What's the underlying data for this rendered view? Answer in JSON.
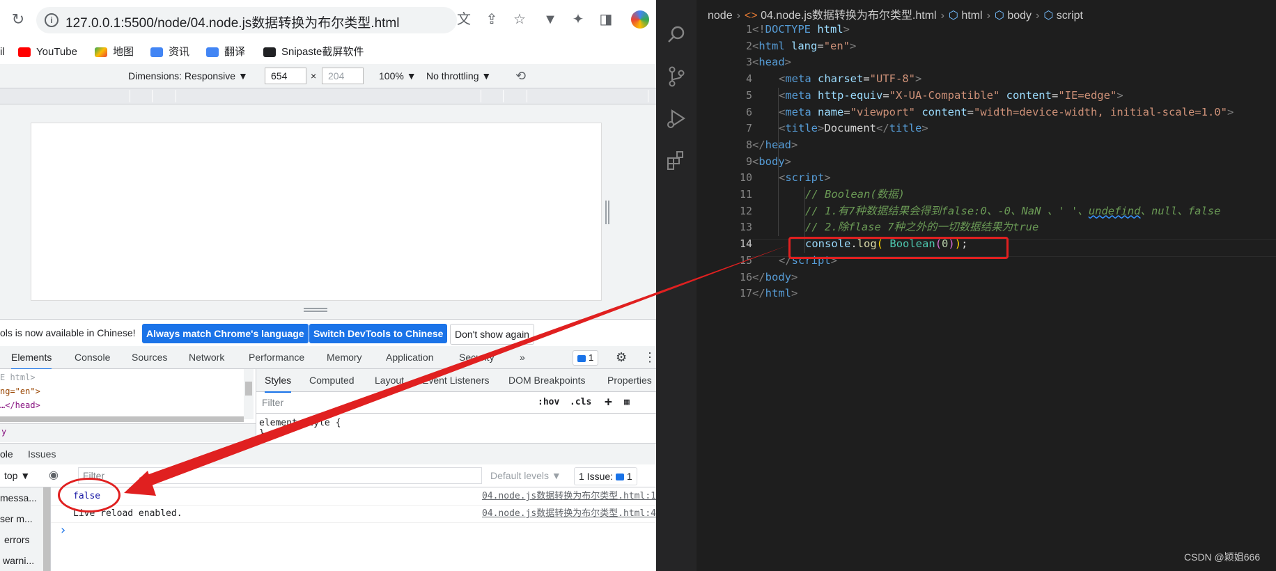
{
  "browser": {
    "url": "127.0.0.1:5500/node/04.node.js数据转换为布尔类型.html",
    "bookmarks": [
      {
        "label": "il"
      },
      {
        "label": "YouTube"
      },
      {
        "label": "地图"
      },
      {
        "label": "资讯"
      },
      {
        "label": "翻译"
      },
      {
        "label": "Snipaste截屏软件"
      }
    ],
    "device_toolbar": {
      "dimensions_label": "Dimensions: Responsive ▼",
      "width": "654",
      "times": "×",
      "height": "204",
      "zoom": "100% ▼",
      "throttle": "No throttling ▼"
    }
  },
  "devtools": {
    "lang_banner": {
      "text": "ols is now available in Chinese!",
      "match_btn": "Always match Chrome's language",
      "switch_btn": "Switch DevTools to Chinese",
      "dismiss_btn": "Don't show again"
    },
    "tabs": [
      "Elements",
      "Console",
      "Sources",
      "Network",
      "Performance",
      "Memory",
      "Application",
      "Security",
      "»"
    ],
    "issues_count": "1",
    "elements_lines": [
      "E html>",
      "ng=\"en\">",
      "…</head>"
    ],
    "crumb": "y",
    "styles_tabs": [
      "Styles",
      "Computed",
      "Layout",
      "Event Listeners",
      "DOM Breakpoints",
      "Properties"
    ],
    "styles_filter_placeholder": "Filter",
    "hov": ":hov",
    "cls": ".cls",
    "element_style": "element.style {",
    "element_style_close": "}",
    "drawer_tabs": [
      "ole",
      "Issues"
    ],
    "console_context": "top ▼",
    "console_filter_placeholder": "Filter",
    "default_levels": "Default levels ▼",
    "issue_summary": "1 Issue:",
    "issue_summary_count": "1",
    "sidebar_items": [
      "messa...",
      "ser m...",
      "errors",
      "warni..."
    ],
    "messages": [
      {
        "text": "false",
        "source": "04.node.js数据转换为布尔类型.html:1"
      },
      {
        "text": "Live reload enabled.",
        "source": "04.node.js数据转换为布尔类型.html:4"
      }
    ],
    "prompt": "›"
  },
  "vscode": {
    "breadcrumb": [
      "node",
      "04.node.js数据转换为布尔类型.html",
      "html",
      "body",
      "script"
    ],
    "current_line": "14",
    "line_numbers": [
      "1",
      "2",
      "3",
      "4",
      "5",
      "6",
      "7",
      "8",
      "9",
      "10",
      "11",
      "12",
      "13",
      "14",
      "15",
      "16",
      "17"
    ],
    "code": {
      "l1": [
        "<!",
        "DOCTYPE",
        " html",
        ">"
      ],
      "l2": [
        "<",
        "html",
        " lang",
        "=",
        "\"en\"",
        ">"
      ],
      "l3": [
        "<",
        "head",
        ">"
      ],
      "l4": [
        "<",
        "meta",
        " charset",
        "=",
        "\"UTF-8\"",
        ">"
      ],
      "l5": [
        "<",
        "meta",
        " http-equiv",
        "=",
        "\"X-UA-Compatible\"",
        " content",
        "=",
        "\"IE=edge\"",
        ">"
      ],
      "l6": [
        "<",
        "meta",
        " name",
        "=",
        "\"viewport\"",
        " content",
        "=",
        "\"width=device-width, initial-scale=1.0\"",
        ">"
      ],
      "l7": [
        "<",
        "title",
        ">",
        "Document",
        "</",
        "title",
        ">"
      ],
      "l8": [
        "</",
        "head",
        ">"
      ],
      "l9": [
        "<",
        "body",
        ">"
      ],
      "l10": [
        "<",
        "script",
        ">"
      ],
      "l11": "// Boolean(数据)",
      "l12a": "// 1.有7种数据结果会得到false:0、-0、NaN 、' '、",
      "l12b": "undefind",
      "l12c": "、null、false",
      "l13": "// 2.除flase 7种之外的一切数据结果为true",
      "l14": [
        "console",
        ".",
        "log",
        "(",
        " ",
        "Boolean",
        "(",
        "0",
        ")",
        ")",
        ";"
      ],
      "l15": [
        "</",
        "script",
        ">"
      ],
      "l16": [
        "</",
        "body",
        ">"
      ],
      "l17": [
        "</",
        "html",
        ">"
      ]
    },
    "watermark": "CSDN @颖姐666"
  },
  "colors": {
    "annotation_red": "#e02020",
    "chrome_blue": "#1a73e8",
    "editor_bg": "#1e1e1e"
  }
}
